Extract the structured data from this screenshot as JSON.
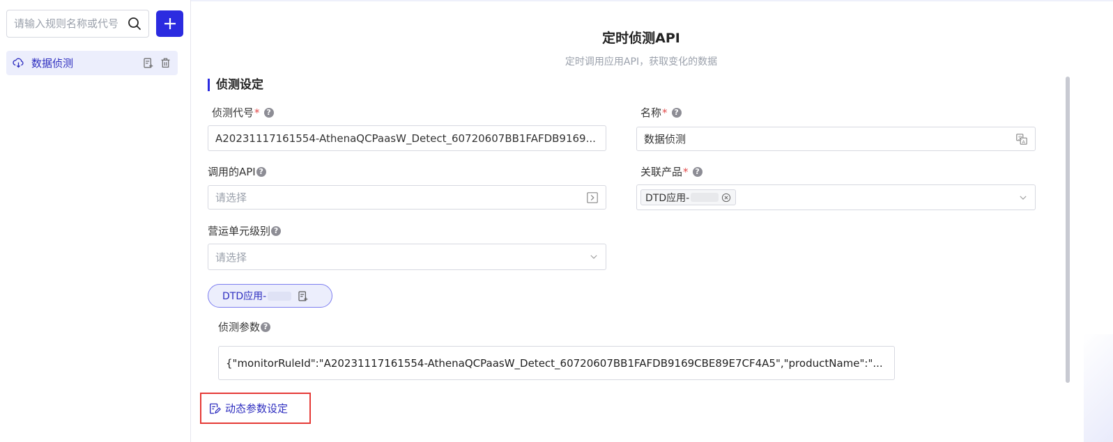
{
  "sidebar": {
    "search_placeholder": "请输入规则名称或代号",
    "add_icon": "plus-icon",
    "items": [
      {
        "label": "数据侦测",
        "icon": "cloud-download-icon",
        "actions": [
          "copy-icon",
          "trash-icon"
        ]
      }
    ]
  },
  "header": {
    "title": "定时侦测API",
    "subtitle": "定时调用应用API，获取变化的数据"
  },
  "section": {
    "title": "侦测设定"
  },
  "form": {
    "detect_code": {
      "label": "侦测代号",
      "required_mark": "*",
      "value": "A20231117161554-AthenaQCPaasW_Detect_60720607BB1FAFDB9169..."
    },
    "name": {
      "label": "名称",
      "required_mark": "*",
      "value": "数据侦测"
    },
    "api": {
      "label": "调用的API",
      "placeholder": "请选择"
    },
    "product": {
      "label": "关联产品",
      "required_mark": "*",
      "tag": "DTD应用-"
    },
    "unit_level": {
      "label": "营运单元级别",
      "placeholder": "请选择"
    },
    "help_symbol": "?"
  },
  "dtd_pill": {
    "label": "DTD应用-"
  },
  "params": {
    "label": "侦测参数",
    "value": "{\"monitorRuleId\":\"A20231117161554-AthenaQCPaasW_Detect_60720607BB1FAFDB9169CBE89E7CF4A5\",\"productName\":\"..."
  },
  "dynamic_button": {
    "label": "动态参数设定"
  },
  "colors": {
    "accent": "#2b2be0",
    "required": "#e24a4a",
    "highlight_border": "#e53935"
  }
}
